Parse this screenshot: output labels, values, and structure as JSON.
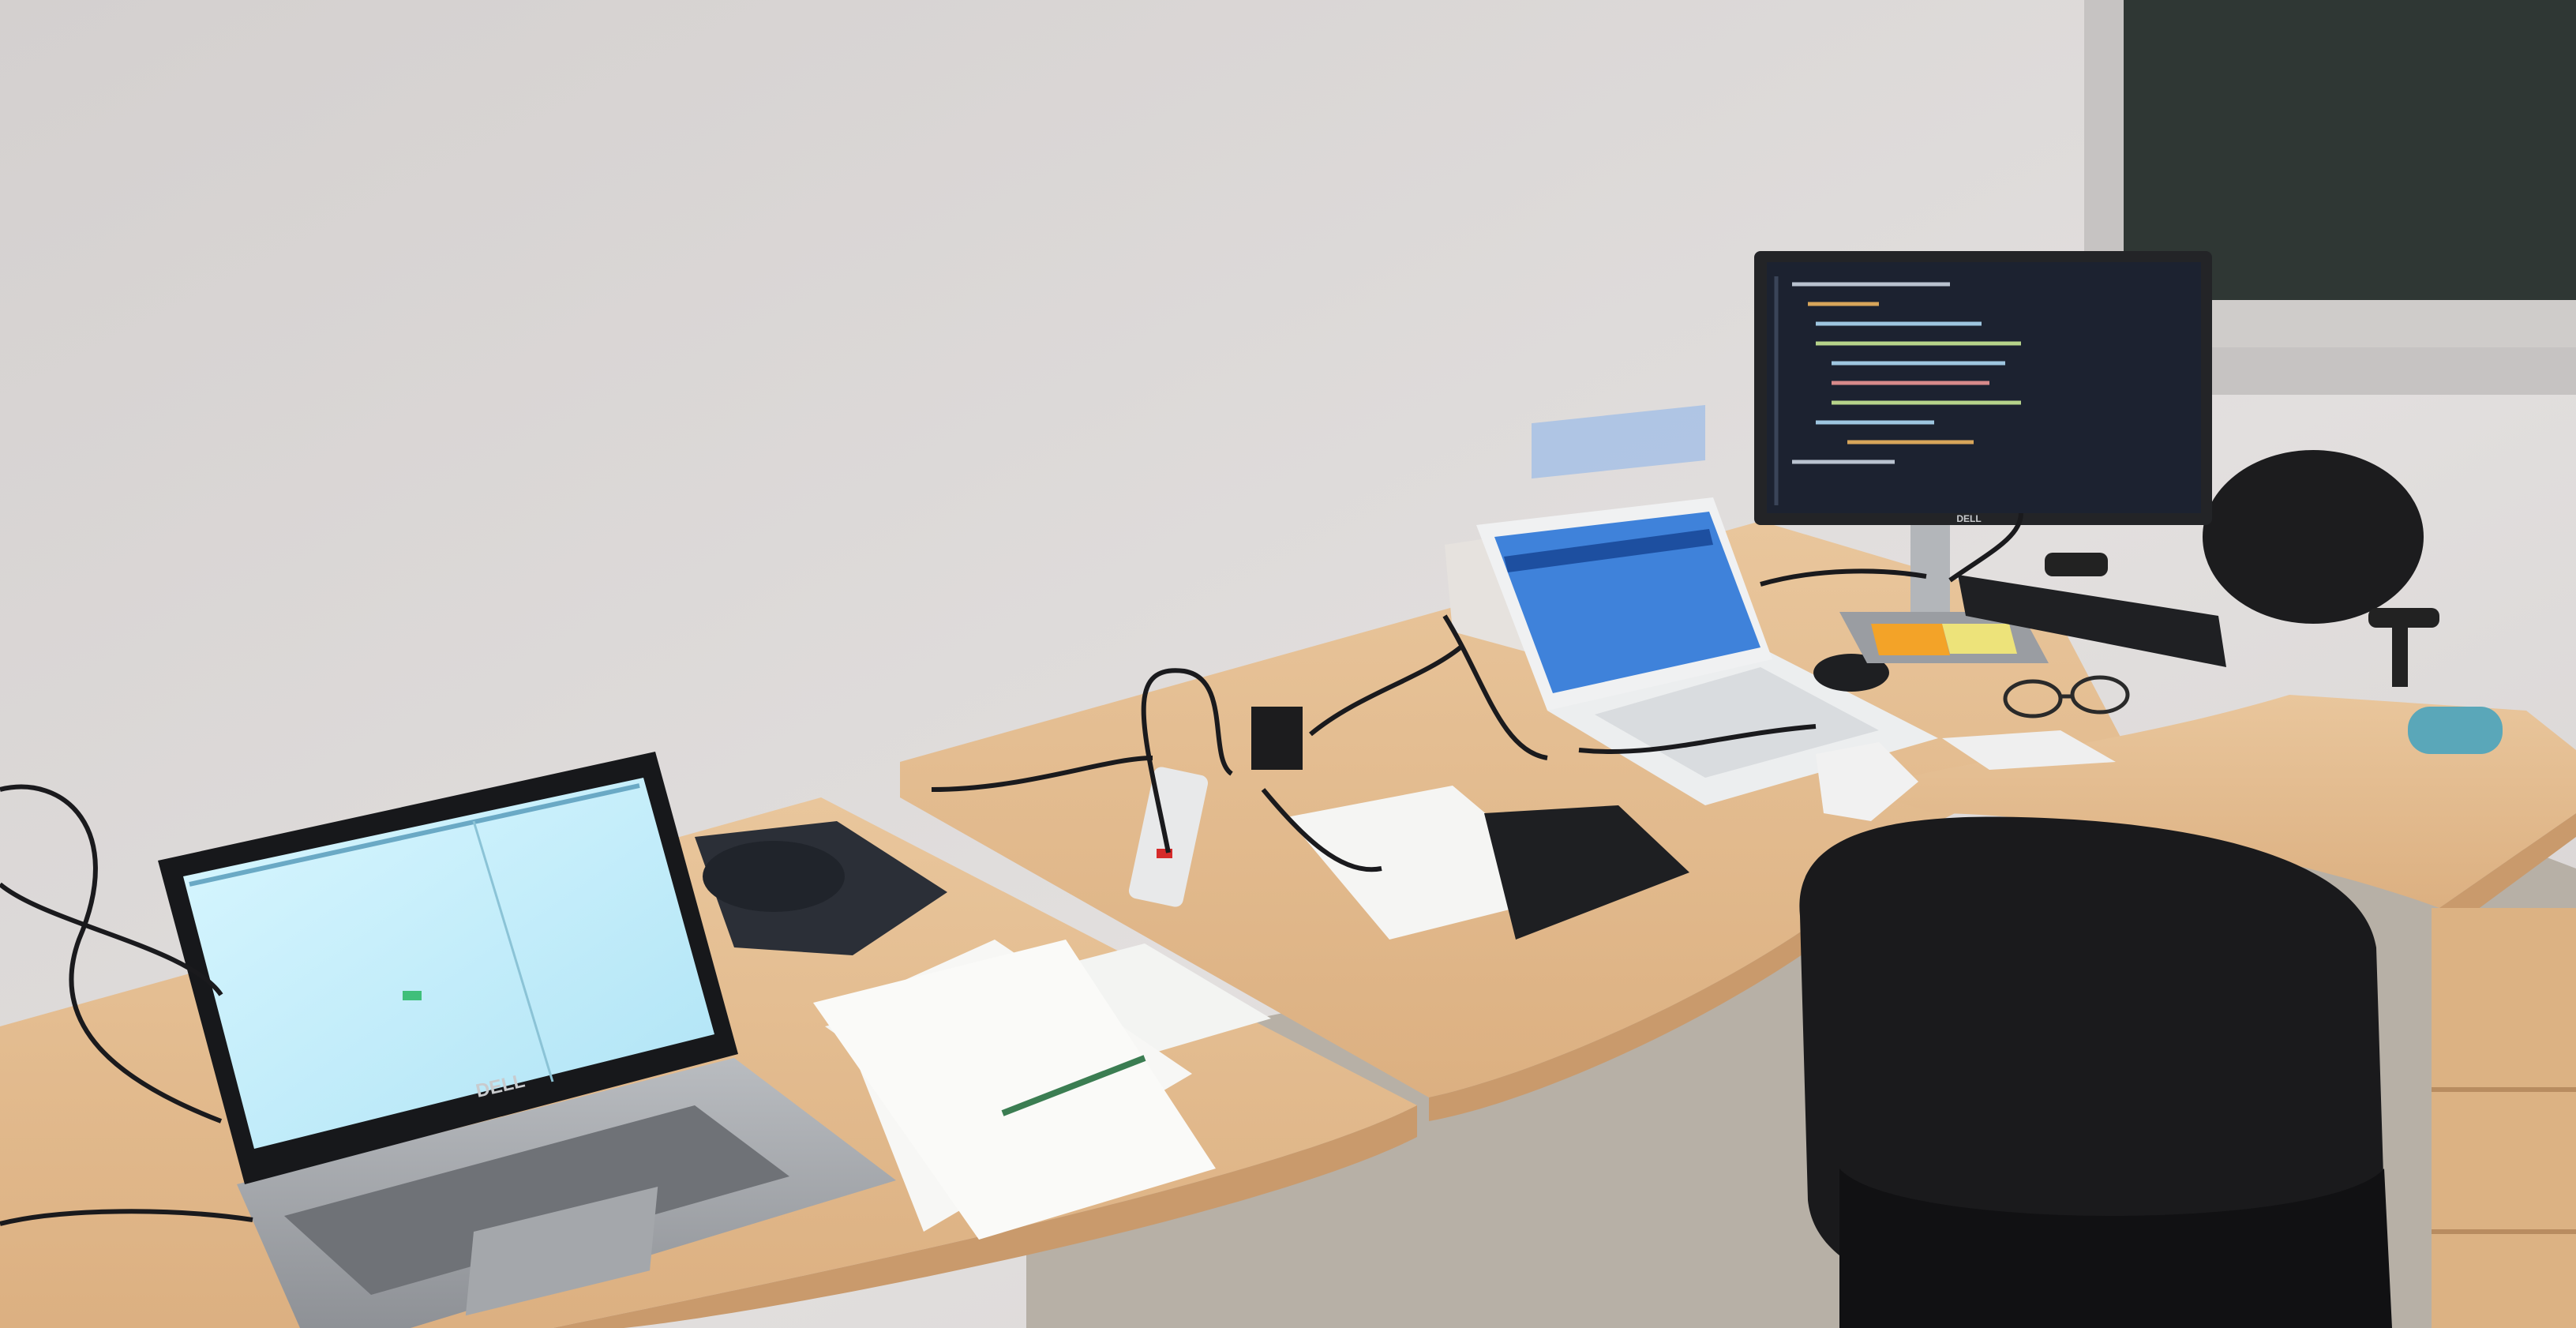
{
  "scene": {
    "description_tags": [
      "office",
      "desk",
      "laptops",
      "monitor",
      "chairs"
    ],
    "colors": {
      "wall": "#dedad9",
      "desk": "#e3b98a",
      "desk_edge": "#c99a6c",
      "floor": "#b9b2a8",
      "screen_bright": "#c9f2ff",
      "screen_blue": "#3d7fd8",
      "monitor_code_bg": "#1c2230",
      "chair": "#1a1a1c",
      "window": "#2e3633"
    }
  },
  "laptop_left": {
    "brand": "DELL"
  },
  "monitor": {
    "brand": "DELL"
  },
  "laptop_right": {
    "brand": ""
  }
}
